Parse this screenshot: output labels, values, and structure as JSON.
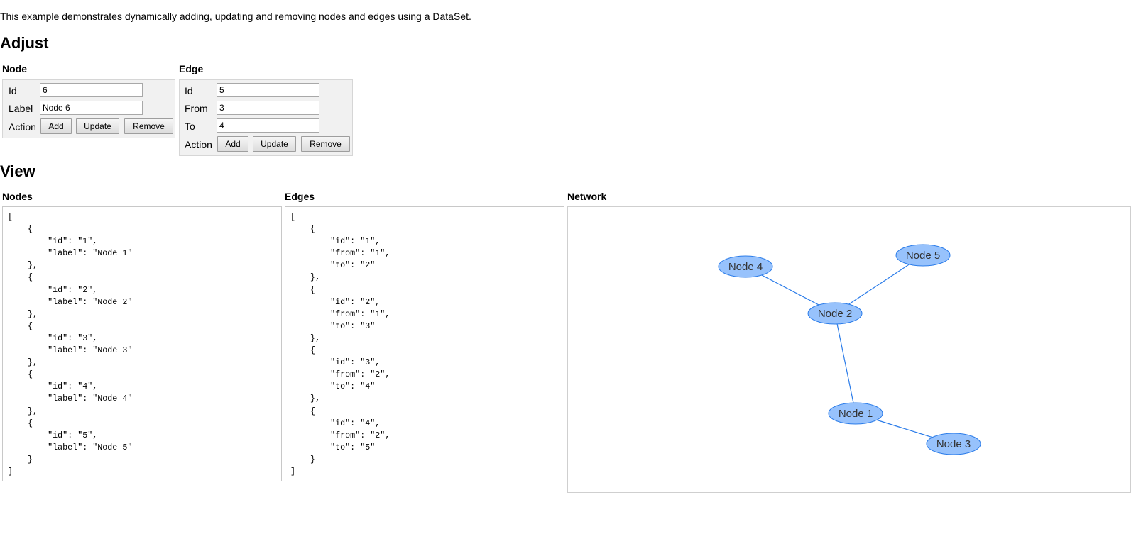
{
  "intro": "This example demonstrates dynamically adding, updating and removing nodes and edges using a DataSet.",
  "adjust": {
    "heading": "Adjust",
    "node": {
      "title": "Node",
      "id_label": "Id",
      "id_value": "6",
      "label_label": "Label",
      "label_value": "Node 6",
      "action_label": "Action",
      "add": "Add",
      "update": "Update",
      "remove": "Remove"
    },
    "edge": {
      "title": "Edge",
      "id_label": "Id",
      "id_value": "5",
      "from_label": "From",
      "from_value": "3",
      "to_label": "To",
      "to_value": "4",
      "action_label": "Action",
      "add": "Add",
      "update": "Update",
      "remove": "Remove"
    }
  },
  "view": {
    "heading": "View",
    "nodes_title": "Nodes",
    "edges_title": "Edges",
    "network_title": "Network",
    "nodes_json": "[\n    {\n        \"id\": \"1\",\n        \"label\": \"Node 1\"\n    },\n    {\n        \"id\": \"2\",\n        \"label\": \"Node 2\"\n    },\n    {\n        \"id\": \"3\",\n        \"label\": \"Node 3\"\n    },\n    {\n        \"id\": \"4\",\n        \"label\": \"Node 4\"\n    },\n    {\n        \"id\": \"5\",\n        \"label\": \"Node 5\"\n    }\n]",
    "edges_json": "[\n    {\n        \"id\": \"1\",\n        \"from\": \"1\",\n        \"to\": \"2\"\n    },\n    {\n        \"id\": \"2\",\n        \"from\": \"1\",\n        \"to\": \"3\"\n    },\n    {\n        \"id\": \"3\",\n        \"from\": \"2\",\n        \"to\": \"4\"\n    },\n    {\n        \"id\": \"4\",\n        \"from\": \"2\",\n        \"to\": \"5\"\n    }\n]"
  },
  "network": {
    "node_fill": "#97c2fc",
    "node_stroke": "#2b7ce9",
    "edge_color": "#2b7ce9",
    "nodes": [
      {
        "id": "1",
        "label": "Node 1"
      },
      {
        "id": "2",
        "label": "Node 2"
      },
      {
        "id": "3",
        "label": "Node 3"
      },
      {
        "id": "4",
        "label": "Node 4"
      },
      {
        "id": "5",
        "label": "Node 5"
      }
    ],
    "edges": [
      {
        "from": "1",
        "to": "2"
      },
      {
        "from": "1",
        "to": "3"
      },
      {
        "from": "2",
        "to": "4"
      },
      {
        "from": "2",
        "to": "5"
      }
    ]
  }
}
